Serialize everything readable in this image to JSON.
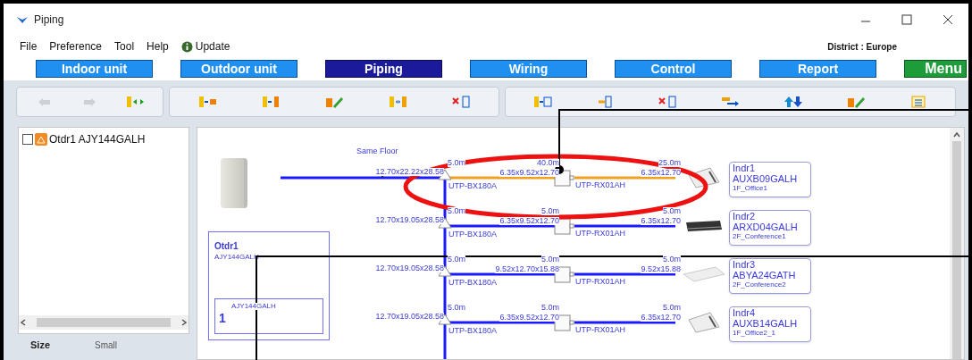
{
  "window": {
    "title": "Piping"
  },
  "menu": [
    "File",
    "Preference",
    "Tool",
    "Help",
    "Update"
  ],
  "district": "District : Europe",
  "tabs": [
    {
      "label": "Indoor unit",
      "selected": false,
      "kind": "tab"
    },
    {
      "label": "Outdoor unit",
      "selected": false,
      "kind": "tab"
    },
    {
      "label": "Piping",
      "selected": true,
      "kind": "tab"
    },
    {
      "label": "Wiring",
      "selected": false,
      "kind": "tab"
    },
    {
      "label": "Control",
      "selected": false,
      "kind": "tab"
    },
    {
      "label": "Report",
      "selected": false,
      "kind": "tab"
    },
    {
      "label": "Menu",
      "selected": false,
      "kind": "menu"
    }
  ],
  "toolbar": [
    [
      {
        "kind": "undo",
        "disabled": true
      },
      {
        "kind": "redo",
        "disabled": true
      },
      {
        "kind": "exchange",
        "disabled": false
      }
    ],
    [
      {
        "kind": "addunit",
        "disabled": false
      },
      {
        "kind": "addoutdoor",
        "disabled": false
      },
      {
        "kind": "edit",
        "disabled": false
      },
      {
        "kind": "swap",
        "disabled": false
      },
      {
        "kind": "delete",
        "disabled": false
      }
    ],
    [
      {
        "kind": "addbranch",
        "disabled": false
      },
      {
        "kind": "insert",
        "disabled": false
      },
      {
        "kind": "delete",
        "disabled": false
      },
      {
        "kind": "move",
        "disabled": false
      },
      {
        "kind": "updown",
        "disabled": false
      },
      {
        "kind": "edit",
        "disabled": false
      },
      {
        "kind": "list",
        "disabled": false
      }
    ]
  ],
  "tree": [
    {
      "label": "Otdr1 AJY144GALH",
      "checked": false
    }
  ],
  "options": {
    "label": "Size",
    "value": "Small"
  },
  "diagram": {
    "floor_label": "Same Floor",
    "outdoor": {
      "name": "Otdr1",
      "model": "AJY144GALH",
      "sub_model": "AJY144GALH",
      "count": "1"
    },
    "branches": [
      {
        "left_length": "5.0m",
        "left_size": "12.70x22.22x28.58",
        "joint": "UTP-BX180A",
        "mid_length": "40.0m",
        "mid_size": "6.35x9.52x12.70",
        "header": "UTP-RX01AH",
        "right_length": "25.0m",
        "right_size": "6.35x12.70",
        "selected": true,
        "kind": "cassette",
        "indoor": {
          "name": "Indr1",
          "model": "AUXB09GALH",
          "room": "1F_Office1"
        }
      },
      {
        "left_length": "5.0m",
        "left_size": "12.70x19.05x28.58",
        "joint": "UTP-BX180A",
        "mid_length": "5.0m",
        "mid_size": "6.35x9.52x12.70",
        "header": "UTP-RX01AH",
        "right_length": "5.0m",
        "right_size": "6.35x12.70",
        "selected": false,
        "kind": "duct",
        "indoor": {
          "name": "Indr2",
          "model": "ARXD04GALH",
          "room": "2F_Conference1"
        }
      },
      {
        "left_length": "5.0m",
        "left_size": "12.70x19.05x28.58",
        "joint": "UTP-BX180A",
        "mid_length": "5.0m",
        "mid_size": "9.52x12.70x15.88",
        "header": "UTP-RX01AH",
        "right_length": "5.0m",
        "right_size": "9.52x15.88",
        "selected": false,
        "kind": "ceiling",
        "indoor": {
          "name": "Indr3",
          "model": "ABYA24GATH",
          "room": "2F_Conference2"
        }
      },
      {
        "left_length": "5.0m",
        "left_size": "12.70x19.05x28.58",
        "joint": "UTP-BX180A",
        "mid_length": "5.0m",
        "mid_size": "6.35x9.52x12.70",
        "header": "UTP-RX01AH",
        "right_length": "5.0m",
        "right_size": "6.35x12.70",
        "selected": false,
        "kind": "cassette",
        "indoor": {
          "name": "Indr4",
          "model": "AUXB14GALH",
          "room": "1F_Office2_1"
        }
      }
    ]
  }
}
